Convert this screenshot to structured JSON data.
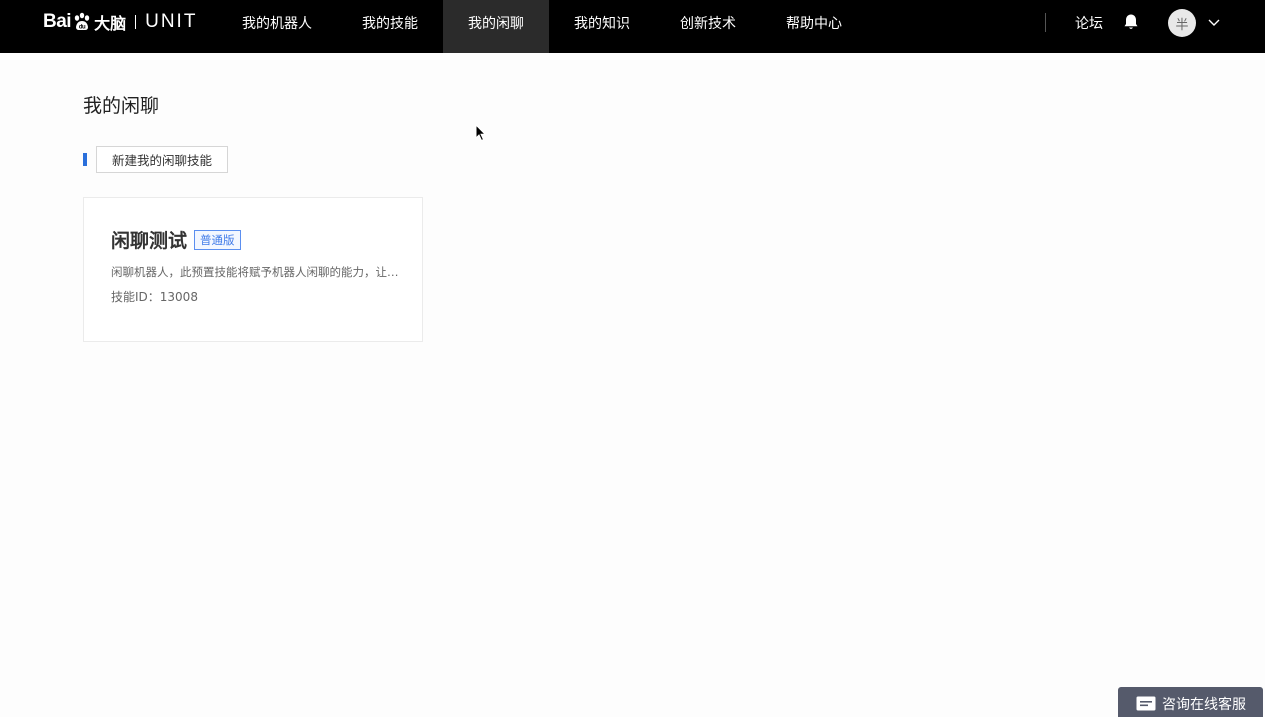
{
  "brand": {
    "baidu_prefix": "Bai",
    "baidu_suffix": "u",
    "product_cn": "大脑",
    "product": "UNIT"
  },
  "nav": {
    "items": [
      {
        "label": "我的机器人",
        "active": false
      },
      {
        "label": "我的技能",
        "active": false
      },
      {
        "label": "我的闲聊",
        "active": true
      },
      {
        "label": "我的知识",
        "active": false
      },
      {
        "label": "创新技术",
        "active": false
      },
      {
        "label": "帮助中心",
        "active": false
      }
    ],
    "forum": "论坛",
    "avatar_text": "半"
  },
  "page": {
    "title": "我的闲聊",
    "create_button": "新建我的闲聊技能"
  },
  "card": {
    "title": "闲聊测试",
    "badge": "普通版",
    "description": "闲聊机器人，此预置技能将赋予机器人闲聊的能力，让机器人能够更好地与用户进行闲聊",
    "id_text": "技能ID：13008"
  },
  "support": {
    "label": "咨询在线客服"
  },
  "colors": {
    "topbar": "#000000",
    "nav_active": "#2b2b2b",
    "accent": "#2a6fdb",
    "badge": "#3f7ae8",
    "support": "#555a6b"
  }
}
